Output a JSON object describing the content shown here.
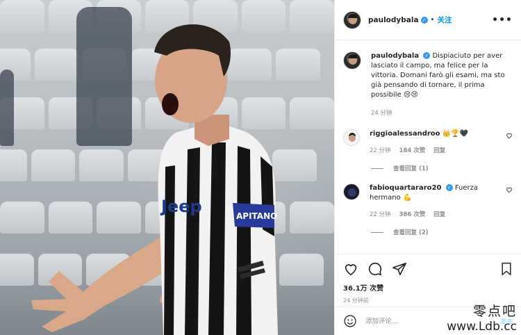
{
  "post": {
    "username": "paulodybala",
    "follow_label": "关注",
    "more_label": "•••",
    "caption": "Dispiaciuto per aver lasciato il campo, ma felice per la vittoria. Domani farò gli esami, ma sto già pensando di tornare, il prima possibile",
    "caption_emoji": "😢😢",
    "caption_time": "24 分钟",
    "photo": {
      "jersey_text": "APITANO",
      "sponsor_text": "Jeep"
    }
  },
  "comments": [
    {
      "username": "riggioalessandroo",
      "text": "👑🏆🖤",
      "time": "22 分钟",
      "likes": "184 次赞",
      "reply": "回复",
      "view_replies": "查看回复 (1)"
    },
    {
      "username": "fabioquartararo20",
      "text": "Fuerza hermano",
      "text_emoji": "💪",
      "time": "22 分钟",
      "likes": "386 次赞",
      "reply": "回复",
      "view_replies": "查看回复 (2)"
    }
  ],
  "actions": {
    "likes": "36.1万 次赞",
    "time": "24 分钟前",
    "icons": [
      "heart-icon",
      "comment-icon",
      "share-icon",
      "bookmark-icon"
    ]
  },
  "add_comment": {
    "placeholder": "添加评论...",
    "post_label": "发布"
  },
  "watermark": {
    "line1": "零点吧",
    "line2": "www.Ldb.cc"
  },
  "colors": {
    "accent": "#0095f6",
    "verified": "#3897f0",
    "muted": "#8e8e8e"
  }
}
